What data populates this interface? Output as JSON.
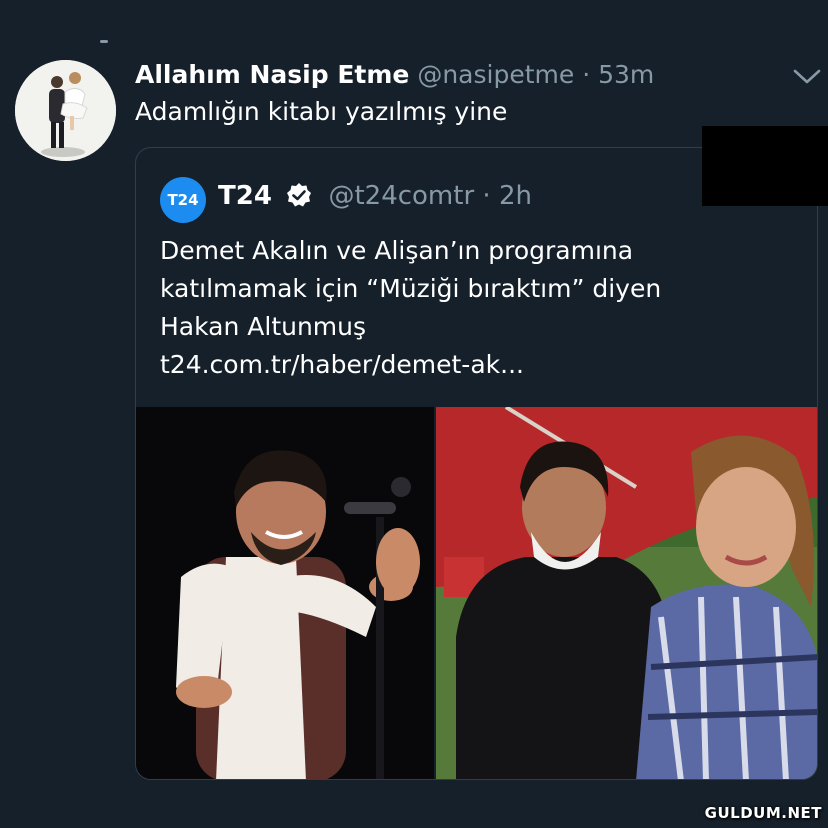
{
  "tweet": {
    "display_name": "Allahım Nasip Etme",
    "handle": "@nasipetme",
    "separator": "·",
    "time": "53m",
    "text": "Adamlığın kitabı yazılmış yine",
    "menu_icon": "chevron-down-icon",
    "avatar_icon": "profile-photo"
  },
  "quoted_tweet": {
    "logo_text": "T24",
    "display_name": "T24",
    "verified_icon": "verified-badge-icon",
    "handle": "@t24comtr",
    "separator": "·",
    "time": "2h",
    "lines": [
      "Demet Akalın ve Alişan’ın programına",
      "katılmamak için “Müziği bıraktım” diyen",
      "Hakan Altunmuş",
      "t24.com.tr/haber/demet-ak..."
    ],
    "images": [
      "singer-on-stage-photo",
      "couple-under-umbrella-photo"
    ]
  },
  "watermark": "GULDUM.NET",
  "colors": {
    "background": "#15202b",
    "muted": "#8899a6",
    "border": "#2f3e4e",
    "logo": "#1d8cf0"
  }
}
